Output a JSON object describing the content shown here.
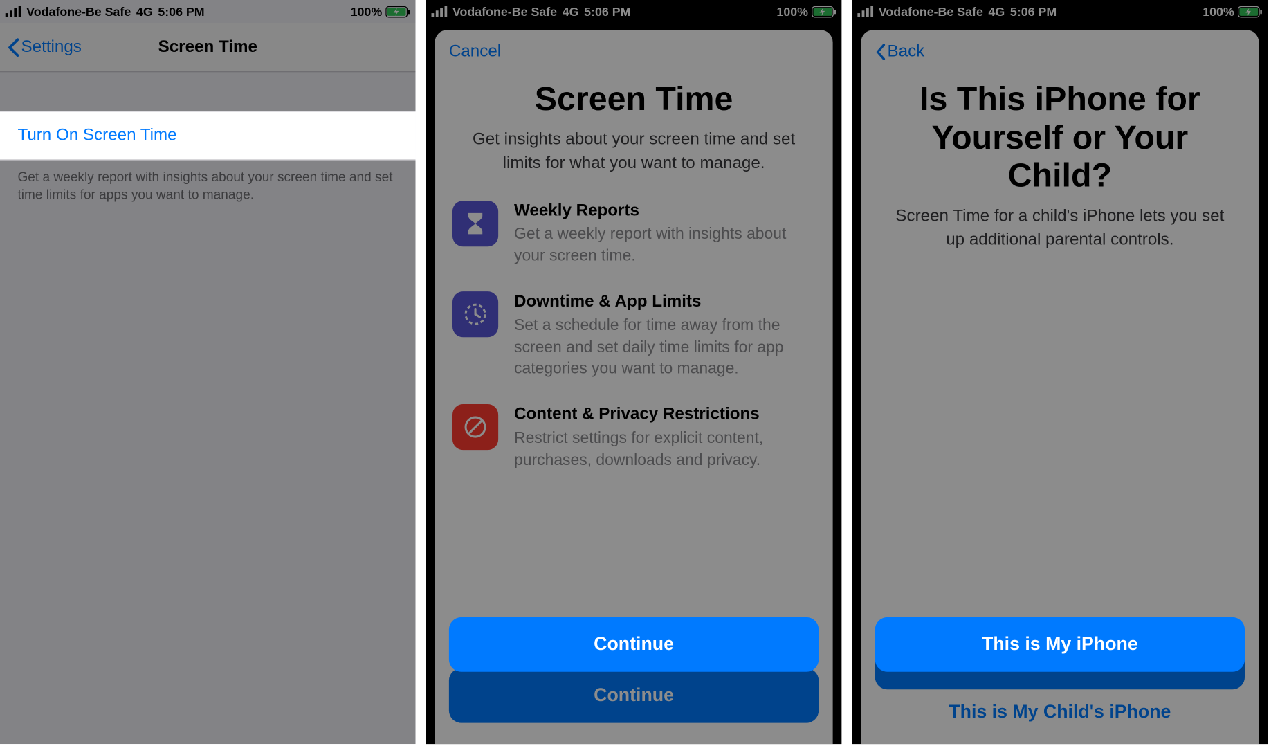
{
  "status": {
    "carrier": "Vodafone-Be Safe",
    "network": "4G",
    "time": "5:06 PM",
    "battery_pct": "100%"
  },
  "screen1": {
    "back_label": "Settings",
    "title": "Screen Time",
    "turn_on": "Turn On Screen Time",
    "footer": "Get a weekly report with insights about your screen time and set time limits for apps you want to manage."
  },
  "screen2": {
    "cancel": "Cancel",
    "title": "Screen Time",
    "subtitle": "Get insights about your screen time and set limits for what you want to manage.",
    "features": [
      {
        "icon": "hourglass-icon",
        "title": "Weekly Reports",
        "desc": "Get a weekly report with insights about your screen time."
      },
      {
        "icon": "clock-limit-icon",
        "title": "Downtime & App Limits",
        "desc": "Set a schedule for time away from the screen and set daily time limits for app categories you want to manage."
      },
      {
        "icon": "no-entry-icon",
        "title": "Content & Privacy Restrictions",
        "desc": "Restrict settings for explicit content, purchases, downloads and privacy."
      }
    ],
    "continue": "Continue"
  },
  "screen3": {
    "back": "Back",
    "title": "Is This iPhone for Yourself or Your Child?",
    "subtitle": "Screen Time for a child's iPhone lets you set up additional parental controls.",
    "primary": "This is My iPhone",
    "secondary": "This is My Child's iPhone"
  }
}
